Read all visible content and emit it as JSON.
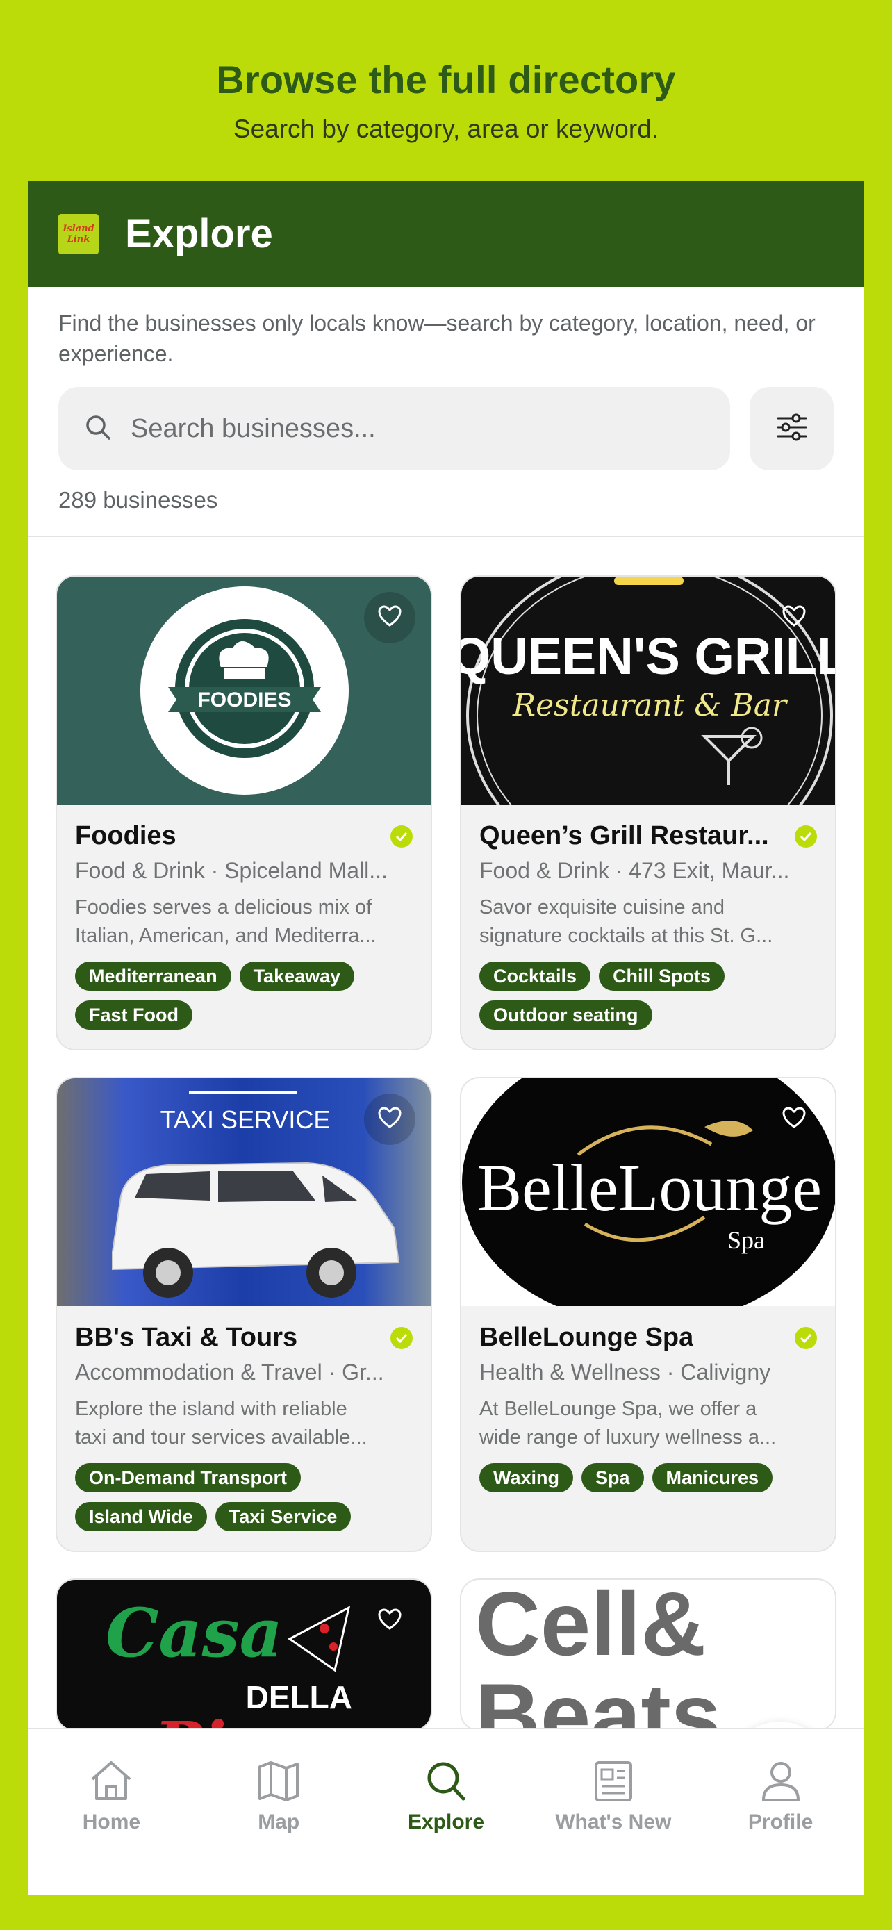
{
  "promo": {
    "title": "Browse the full directory",
    "subtitle": "Search by category, area or keyword."
  },
  "header": {
    "title": "Explore",
    "logo_text": [
      "Island",
      "Link"
    ]
  },
  "intro": "Find the businesses only locals know—search by category, location, need, or experience.",
  "search": {
    "placeholder": "Search businesses..."
  },
  "results_count": "289 businesses",
  "businesses": [
    {
      "name": "Foodies",
      "meta": "Food & Drink · Spiceland Mall...",
      "desc_1": "Foodies serves a delicious mix of",
      "desc_2": "Italian, American, and Mediterra...",
      "tags": [
        "Mediterranean",
        "Takeaway",
        "Fast Food"
      ],
      "image_text": "FOODIES"
    },
    {
      "name": "Queen’s Grill Restaur...",
      "meta": "Food & Drink · 473 Exit, Maur...",
      "desc_1": "Savor exquisite cuisine and",
      "desc_2": "signature cocktails at this St. G...",
      "tags": [
        "Cocktails",
        "Chill Spots",
        "Outdoor seating"
      ],
      "image_text_1": "QUEEN'S  GRILL",
      "image_text_2": "Restaurant & Bar"
    },
    {
      "name": "BB's Taxi & Tours",
      "meta": "Accommodation & Travel · Gr...",
      "desc_1": "Explore the island with reliable",
      "desc_2": "taxi and tour services available...",
      "tags": [
        "On-Demand Transport",
        "Island Wide",
        "Taxi Service"
      ],
      "image_text": "TAXI SERVICE"
    },
    {
      "name": "BelleLounge Spa",
      "meta": "Health & Wellness · Calivigny",
      "desc_1": "At BelleLounge Spa, we offer a",
      "desc_2": "wide range of luxury wellness a...",
      "tags": [
        "Waxing",
        "Spa",
        "Manicures"
      ],
      "image_text_1": "BelleLounge",
      "image_text_2": "Spa"
    },
    {
      "image_text_1": "Casa",
      "image_text_2": "DELLA",
      "image_text_3": "Pizza"
    },
    {
      "image_text_1": "Cell&",
      "image_text_2": "Beats"
    }
  ],
  "tabs": [
    {
      "label": "Home",
      "icon": "home-icon"
    },
    {
      "label": "Map",
      "icon": "map-icon"
    },
    {
      "label": "Explore",
      "icon": "search-icon",
      "active": true
    },
    {
      "label": "What's New",
      "icon": "newspaper-icon"
    },
    {
      "label": "Profile",
      "icon": "person-icon"
    }
  ],
  "colors": {
    "background": "#bcdc0a",
    "brand_dark": "#2d5a16",
    "accent": "#bcdc0a"
  }
}
